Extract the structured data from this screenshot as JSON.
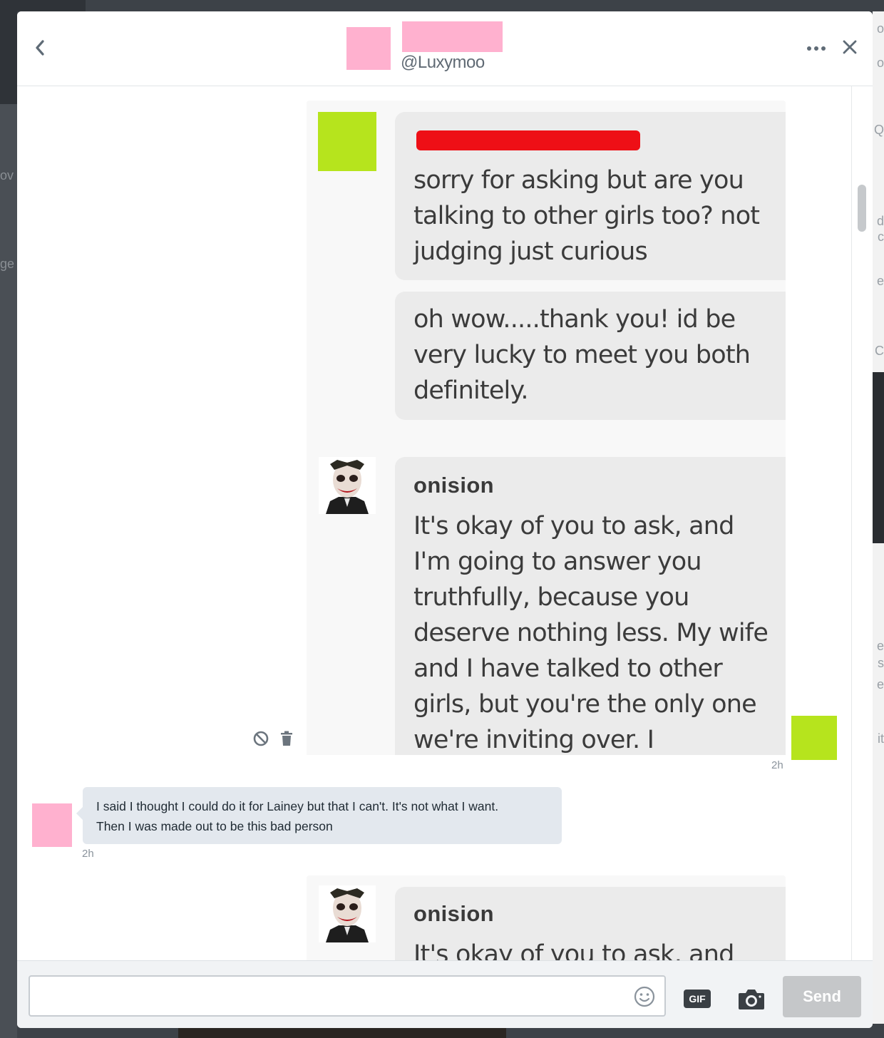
{
  "background": {
    "left_texts": [
      "ov",
      "ge"
    ],
    "right_texts": [
      "o",
      "o",
      "Q",
      "d",
      "c",
      "e",
      "C",
      "e",
      "s",
      "e",
      "it"
    ]
  },
  "header": {
    "handle": "@Luxymoo",
    "back_icon": "chevron-left-icon",
    "more_icon": "more-horizontal-icon",
    "close_icon": "close-icon",
    "avatar_color": "#ffb1cf"
  },
  "conversation": {
    "screenshot1": {
      "bubble1_lines": [
        "sorry for asking but are you",
        "talking to other girls too? not",
        "judging just curious"
      ],
      "bubble2_lines": [
        "oh wow.....thank you! id be",
        "very lucky to meet you both",
        "definitely."
      ],
      "name": "onision",
      "bubble3_lines": [
        "It's okay of you to ask, and",
        "I'm going to answer you",
        "truthfully, because you",
        "deserve nothing less. My wife",
        "and I have talked to other",
        "girls, but you're the only one",
        "we're inviting over. I"
      ],
      "redaction_color": "#ee0f16",
      "avatar_color": "#b6e41d"
    },
    "sent_time": "2h",
    "incoming": {
      "lines": [
        "I said I thought I could do it for Lainey but that I can't. It's not what I want.",
        "Then I was made out to be this bad person"
      ],
      "time": "2h"
    },
    "screenshot2": {
      "name": "onision",
      "partial_line": "It's okay of you to ask, and"
    },
    "actions": {
      "block_icon": "block-icon",
      "delete_icon": "trash-icon"
    }
  },
  "composer": {
    "placeholder": "",
    "emoji_icon": "smiley-icon",
    "gif_label": "GIF",
    "camera_icon": "camera-icon",
    "send_label": "Send"
  },
  "colors": {
    "my_avatar": "#b6e41d",
    "their_avatar": "#ffb1cf",
    "incoming_bubble": "#e3e8ee",
    "send_disabled": "#c5c7c9"
  }
}
